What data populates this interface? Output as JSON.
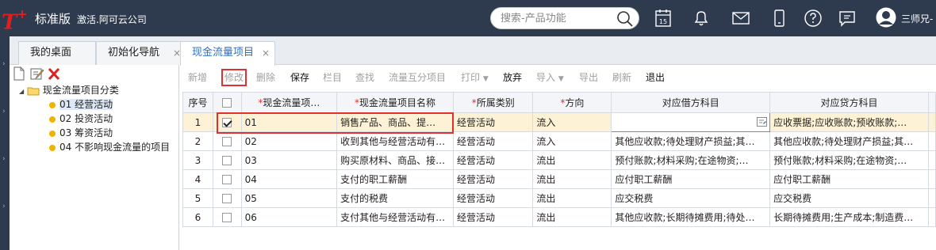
{
  "app": {
    "logo": "T",
    "logo_plus": "+",
    "edition": "标准版",
    "company": "激活.阿可云公司"
  },
  "search": {
    "placeholder": "搜索-产品功能"
  },
  "calendar": {
    "day": "15"
  },
  "user": {
    "name": "三师兄-"
  },
  "tabs": [
    {
      "label": "我的桌面",
      "close": "×"
    },
    {
      "label": "初始化导航",
      "close": "×"
    },
    {
      "label": "现金流量项目",
      "close": "×"
    }
  ],
  "tree": {
    "root": "现金流量项目分类",
    "items": [
      "01 经营活动",
      "02 投资活动",
      "03 筹资活动",
      "04 不影响现金流量的项目"
    ]
  },
  "toolbar": {
    "add": "新增",
    "edit": "修改",
    "delete": "删除",
    "save": "保存",
    "columns": "栏目",
    "find": "查找",
    "split": "流量互分项目",
    "print": "打印",
    "abandon": "放弃",
    "import": "导入",
    "export": "导出",
    "refresh": "刷新",
    "exit": "退出"
  },
  "table": {
    "headers": {
      "index": "序号",
      "code": "现金流量项…",
      "name": "现金流量项目名称",
      "category": "所属类别",
      "direction": "方向",
      "debit": "对应借方科目",
      "credit": "对应贷方科目"
    },
    "rows": [
      {
        "index": "1",
        "checked": true,
        "code": "01",
        "name": "销售产品、商品、提…",
        "category": "经营活动",
        "direction": "流入",
        "debit": "",
        "credit": "应收票据;应收账款;预收账款;…"
      },
      {
        "index": "2",
        "checked": false,
        "code": "02",
        "name": "收到其他与经营活动有…",
        "category": "经营活动",
        "direction": "流入",
        "debit": "其他应收款;待处理财产损益;其…",
        "credit": "其他应收款;待处理财产损益;其…"
      },
      {
        "index": "3",
        "checked": false,
        "code": "03",
        "name": "购买原材料、商品、接…",
        "category": "经营活动",
        "direction": "流出",
        "debit": "预付账款;材料采购;在途物资;…",
        "credit": "预付账款;材料采购;在途物资;…"
      },
      {
        "index": "4",
        "checked": false,
        "code": "04",
        "name": "支付的职工薪酬",
        "category": "经营活动",
        "direction": "流出",
        "debit": "应付职工薪酬",
        "credit": "应付职工薪酬"
      },
      {
        "index": "5",
        "checked": false,
        "code": "05",
        "name": "支付的税费",
        "category": "经营活动",
        "direction": "流出",
        "debit": "应交税费",
        "credit": "应交税费"
      },
      {
        "index": "6",
        "checked": false,
        "code": "06",
        "name": "支付其他与经营活动有…",
        "category": "经营活动",
        "direction": "流出",
        "debit": "其他应收款;长期待摊费用;待处…",
        "credit": "长期待摊费用;生产成本;制造费…"
      }
    ]
  },
  "colors": {
    "topbar": "#2e3a4d",
    "accent": "#2e6fc0",
    "highlight": "#e03030",
    "selected_row": "#fdf2d6"
  }
}
